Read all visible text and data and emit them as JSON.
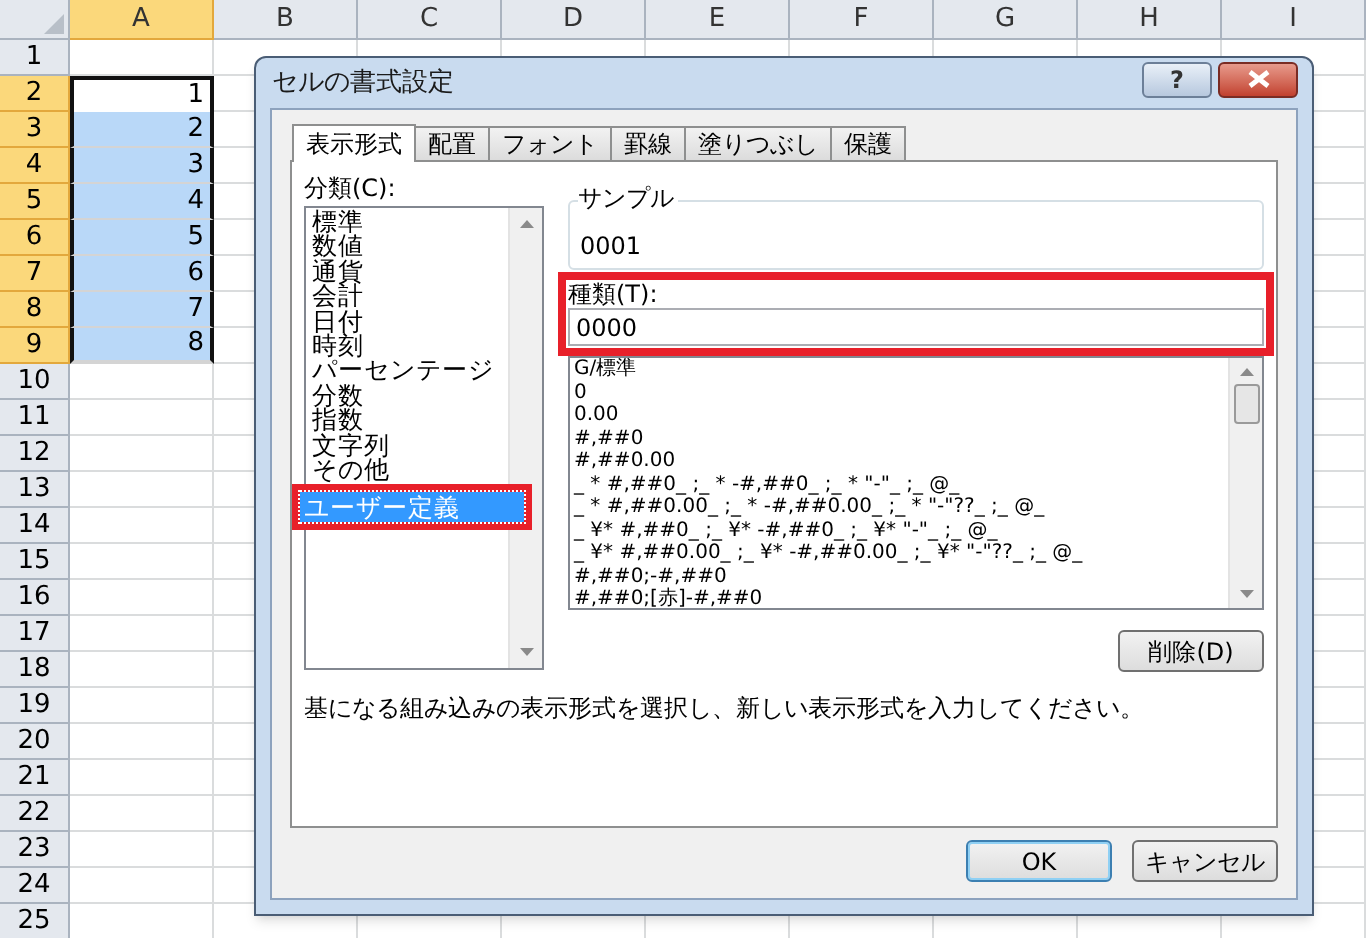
{
  "sheet": {
    "columns": [
      {
        "label": "A",
        "selected": true
      },
      {
        "label": "B",
        "selected": false
      },
      {
        "label": "C",
        "selected": false
      },
      {
        "label": "D",
        "selected": false
      },
      {
        "label": "E",
        "selected": false
      },
      {
        "label": "F",
        "selected": false
      },
      {
        "label": "G",
        "selected": false
      },
      {
        "label": "H",
        "selected": false
      },
      {
        "label": "I",
        "selected": false
      }
    ],
    "rows": [
      {
        "label": "1",
        "selected": false
      },
      {
        "label": "2",
        "selected": true,
        "value": "1",
        "active": true
      },
      {
        "label": "3",
        "selected": true,
        "value": "2",
        "active": false
      },
      {
        "label": "4",
        "selected": true,
        "value": "3",
        "active": false
      },
      {
        "label": "5",
        "selected": true,
        "value": "4",
        "active": false
      },
      {
        "label": "6",
        "selected": true,
        "value": "5",
        "active": false
      },
      {
        "label": "7",
        "selected": true,
        "value": "6",
        "active": false
      },
      {
        "label": "8",
        "selected": true,
        "value": "7",
        "active": false
      },
      {
        "label": "9",
        "selected": true,
        "value": "8",
        "active": false
      },
      {
        "label": "10",
        "selected": false
      },
      {
        "label": "11",
        "selected": false
      },
      {
        "label": "12",
        "selected": false
      },
      {
        "label": "13",
        "selected": false
      },
      {
        "label": "14",
        "selected": false
      },
      {
        "label": "15",
        "selected": false
      },
      {
        "label": "16",
        "selected": false
      },
      {
        "label": "17",
        "selected": false
      },
      {
        "label": "18",
        "selected": false
      },
      {
        "label": "19",
        "selected": false
      },
      {
        "label": "20",
        "selected": false
      },
      {
        "label": "21",
        "selected": false
      },
      {
        "label": "22",
        "selected": false
      },
      {
        "label": "23",
        "selected": false
      },
      {
        "label": "24",
        "selected": false
      },
      {
        "label": "25",
        "selected": false
      }
    ]
  },
  "dialog": {
    "title": "セルの書式設定",
    "help_button": "?",
    "tabs": [
      {
        "label": "表示形式",
        "selected": true
      },
      {
        "label": "配置",
        "selected": false
      },
      {
        "label": "フォント",
        "selected": false
      },
      {
        "label": "罫線",
        "selected": false
      },
      {
        "label": "塗りつぶし",
        "selected": false
      },
      {
        "label": "保護",
        "selected": false
      }
    ],
    "category_label": "分類(C):",
    "categories": [
      {
        "label": "標準",
        "selected": false,
        "highlighted": false
      },
      {
        "label": "数値",
        "selected": false,
        "highlighted": false
      },
      {
        "label": "通貨",
        "selected": false,
        "highlighted": false
      },
      {
        "label": "会計",
        "selected": false,
        "highlighted": false
      },
      {
        "label": "日付",
        "selected": false,
        "highlighted": false
      },
      {
        "label": "時刻",
        "selected": false,
        "highlighted": false
      },
      {
        "label": "パーセンテージ",
        "selected": false,
        "highlighted": false
      },
      {
        "label": "分数",
        "selected": false,
        "highlighted": false
      },
      {
        "label": "指数",
        "selected": false,
        "highlighted": false
      },
      {
        "label": "文字列",
        "selected": false,
        "highlighted": false
      },
      {
        "label": "その他",
        "selected": false,
        "highlighted": false
      },
      {
        "label": "ユーザー定義",
        "selected": true,
        "highlighted": true
      }
    ],
    "sample": {
      "label": "サンプル",
      "value": "0001"
    },
    "type": {
      "label": "種類(T):",
      "value": "0000",
      "highlighted": true
    },
    "formats": [
      "G/標準",
      "0",
      "0.00",
      "#,##0",
      "#,##0.00",
      "_ * #,##0_ ;_ * -#,##0_ ;_ * \"-\"_ ;_ @_",
      "_ * #,##0.00_ ;_ * -#,##0.00_ ;_ * \"-\"??_ ;_ @_",
      "_ ¥* #,##0_ ;_ ¥* -#,##0_ ;_ ¥* \"-\"_ ;_ @_",
      "_ ¥* #,##0.00_ ;_ ¥* -#,##0.00_ ;_ ¥* \"-\"??_ ;_ @_",
      "#,##0;-#,##0",
      "#,##0;[赤]-#,##0"
    ],
    "delete_button": "削除(D)",
    "description": "基になる組み込みの表示形式を選択し、新しい表示形式を入力してください。",
    "buttons": [
      {
        "label": "OK",
        "default": true
      },
      {
        "label": "キャンセル",
        "default": false
      }
    ]
  }
}
